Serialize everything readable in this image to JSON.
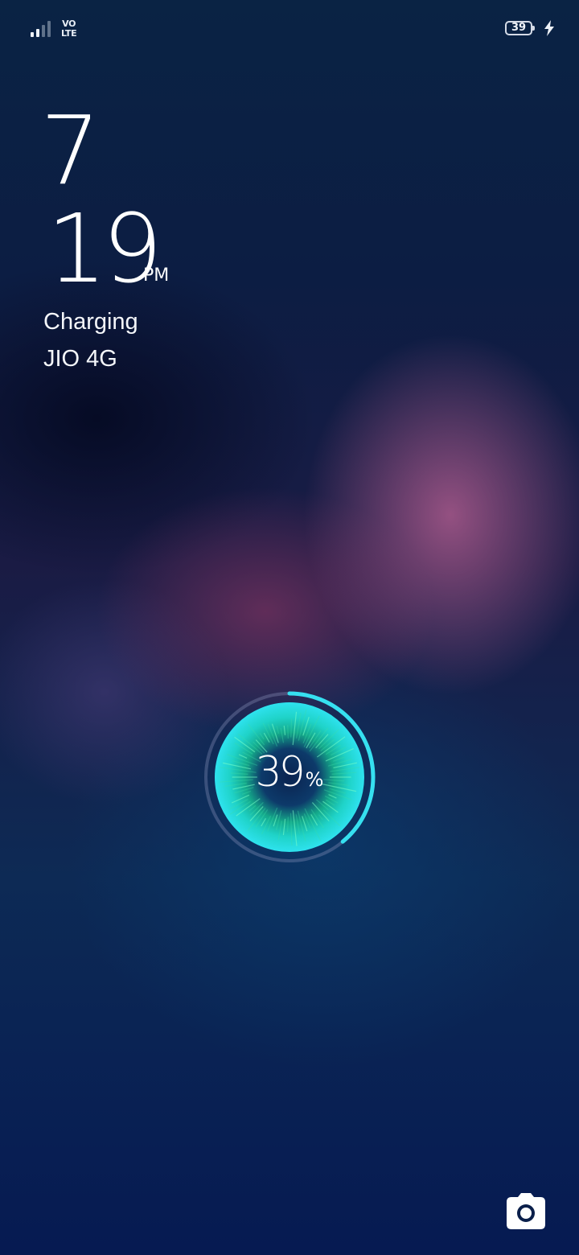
{
  "status_bar": {
    "signal_icon": "cellular-signal-icon",
    "network_badge_line1": "VO",
    "network_badge_line2": "LTE",
    "battery_level": "39",
    "battery_icon": "battery-icon",
    "charging_icon": "lightning-bolt-icon"
  },
  "clock": {
    "hour": "7",
    "minute": "19",
    "ampm": "PM"
  },
  "lock_status": "Charging",
  "carrier": "JIO 4G",
  "charging": {
    "percent_value": "39",
    "percent_unit": "%",
    "fraction": 0.39,
    "accent_color": "#36e0f0",
    "inner_color": "#1fc8d8"
  },
  "camera_shortcut": {
    "icon": "camera-icon"
  }
}
